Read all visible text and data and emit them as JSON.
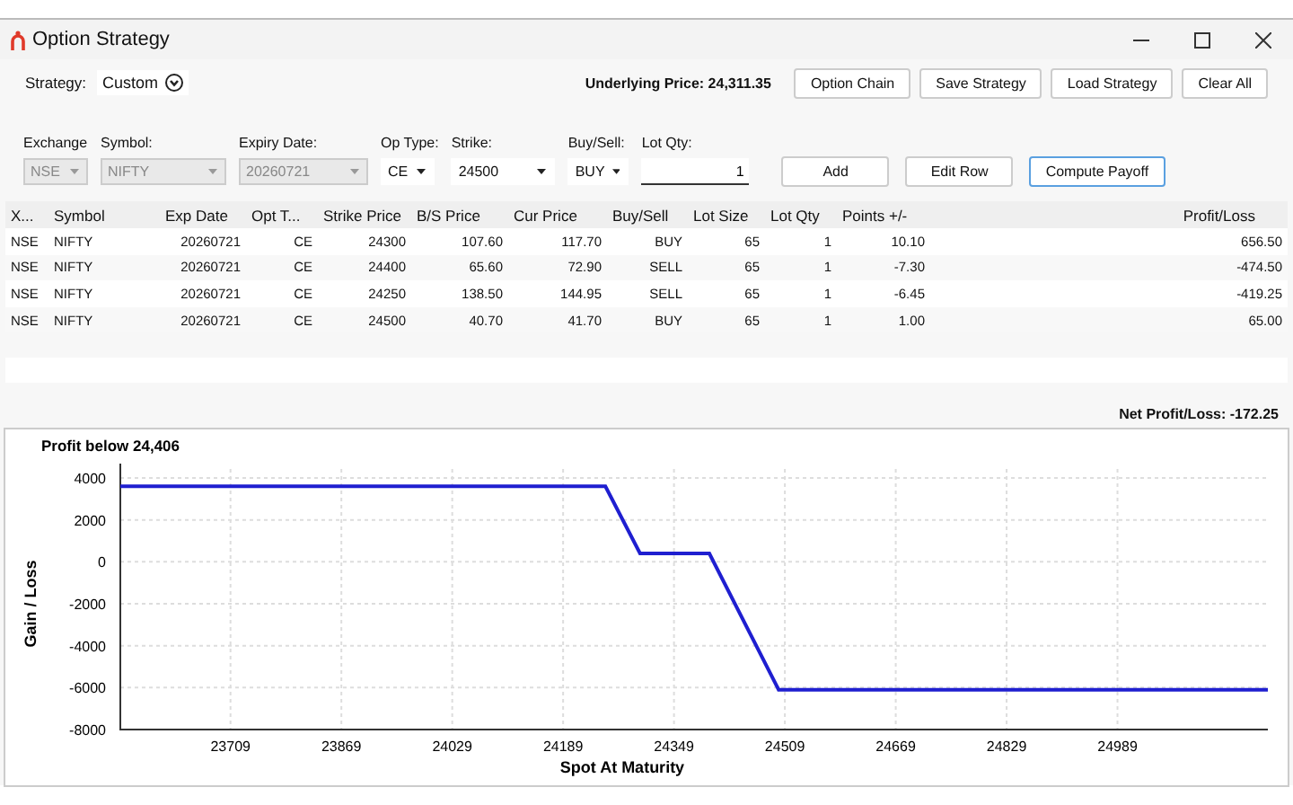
{
  "window": {
    "title": "Option Strategy"
  },
  "strategy": {
    "label": "Strategy:",
    "value": "Custom"
  },
  "underlying": "Underlying Price: 24,311.35",
  "top_buttons": [
    "Option Chain",
    "Save Strategy",
    "Load Strategy",
    "Clear All"
  ],
  "fields": [
    {
      "label": "Exchange",
      "value": "NSE",
      "kind": "combo",
      "disabled": true
    },
    {
      "label": "Symbol:",
      "value": "NIFTY",
      "kind": "combo",
      "disabled": true
    },
    {
      "label": "Expiry Date:",
      "value": "20260721",
      "kind": "combo",
      "disabled": true
    },
    {
      "label": "Op Type:",
      "value": "CE",
      "kind": "combo",
      "disabled": false
    },
    {
      "label": "Strike:",
      "value": "24500",
      "kind": "combo",
      "disabled": false
    },
    {
      "label": "Buy/Sell:",
      "value": "BUY",
      "kind": "combo",
      "disabled": false
    },
    {
      "label": "Lot Qty:",
      "value": "1",
      "kind": "input",
      "disabled": false
    }
  ],
  "form_buttons": [
    {
      "label": "Add",
      "focused": false
    },
    {
      "label": "Edit Row",
      "focused": false
    },
    {
      "label": "Compute Payoff",
      "focused": true
    }
  ],
  "table": {
    "columns": [
      "X...",
      "Symbol",
      "Exp Date",
      "Opt T...",
      "Strike Price",
      "B/S Price",
      "Cur Price",
      "Buy/Sell",
      "Lot Size",
      "Lot Qty",
      "Points +/-",
      "Profit/Loss"
    ],
    "rows": [
      [
        "NSE",
        "NIFTY",
        "20260721",
        "CE",
        "24300",
        "107.60",
        "117.70",
        "BUY",
        "65",
        "1",
        "10.10",
        "656.50"
      ],
      [
        "NSE",
        "NIFTY",
        "20260721",
        "CE",
        "24400",
        "65.60",
        "72.90",
        "SELL",
        "65",
        "1",
        "-7.30",
        "-474.50"
      ],
      [
        "NSE",
        "NIFTY",
        "20260721",
        "CE",
        "24250",
        "138.50",
        "144.95",
        "SELL",
        "65",
        "1",
        "-6.45",
        "-419.25"
      ],
      [
        "NSE",
        "NIFTY",
        "20260721",
        "CE",
        "24500",
        "40.70",
        "41.70",
        "BUY",
        "65",
        "1",
        "1.00",
        "65.00"
      ]
    ]
  },
  "net": "Net Profit/Loss: -172.25",
  "chart": {
    "chart_data": {
      "type": "line",
      "title": "Profit below 24,406",
      "xlabel": "Spot At Maturity",
      "ylabel": "Gain / Loss",
      "x": [
        23550,
        24250,
        24300,
        24400,
        24500,
        25206
      ],
      "series": [
        {
          "color": "#1f1fd0",
          "values": [
            3600,
            3600,
            400,
            400,
            -6100,
            -6100
          ]
        }
      ],
      "grid": true,
      "xlim": [
        23550,
        25206
      ],
      "ylim": [
        -8000,
        4000
      ],
      "xticks": [
        23709,
        23869,
        24029,
        24189,
        24349,
        24509,
        24669,
        24829,
        24989
      ],
      "yticks": [
        -8000,
        -6000,
        -4000,
        -2000,
        0,
        2000,
        4000
      ]
    }
  }
}
